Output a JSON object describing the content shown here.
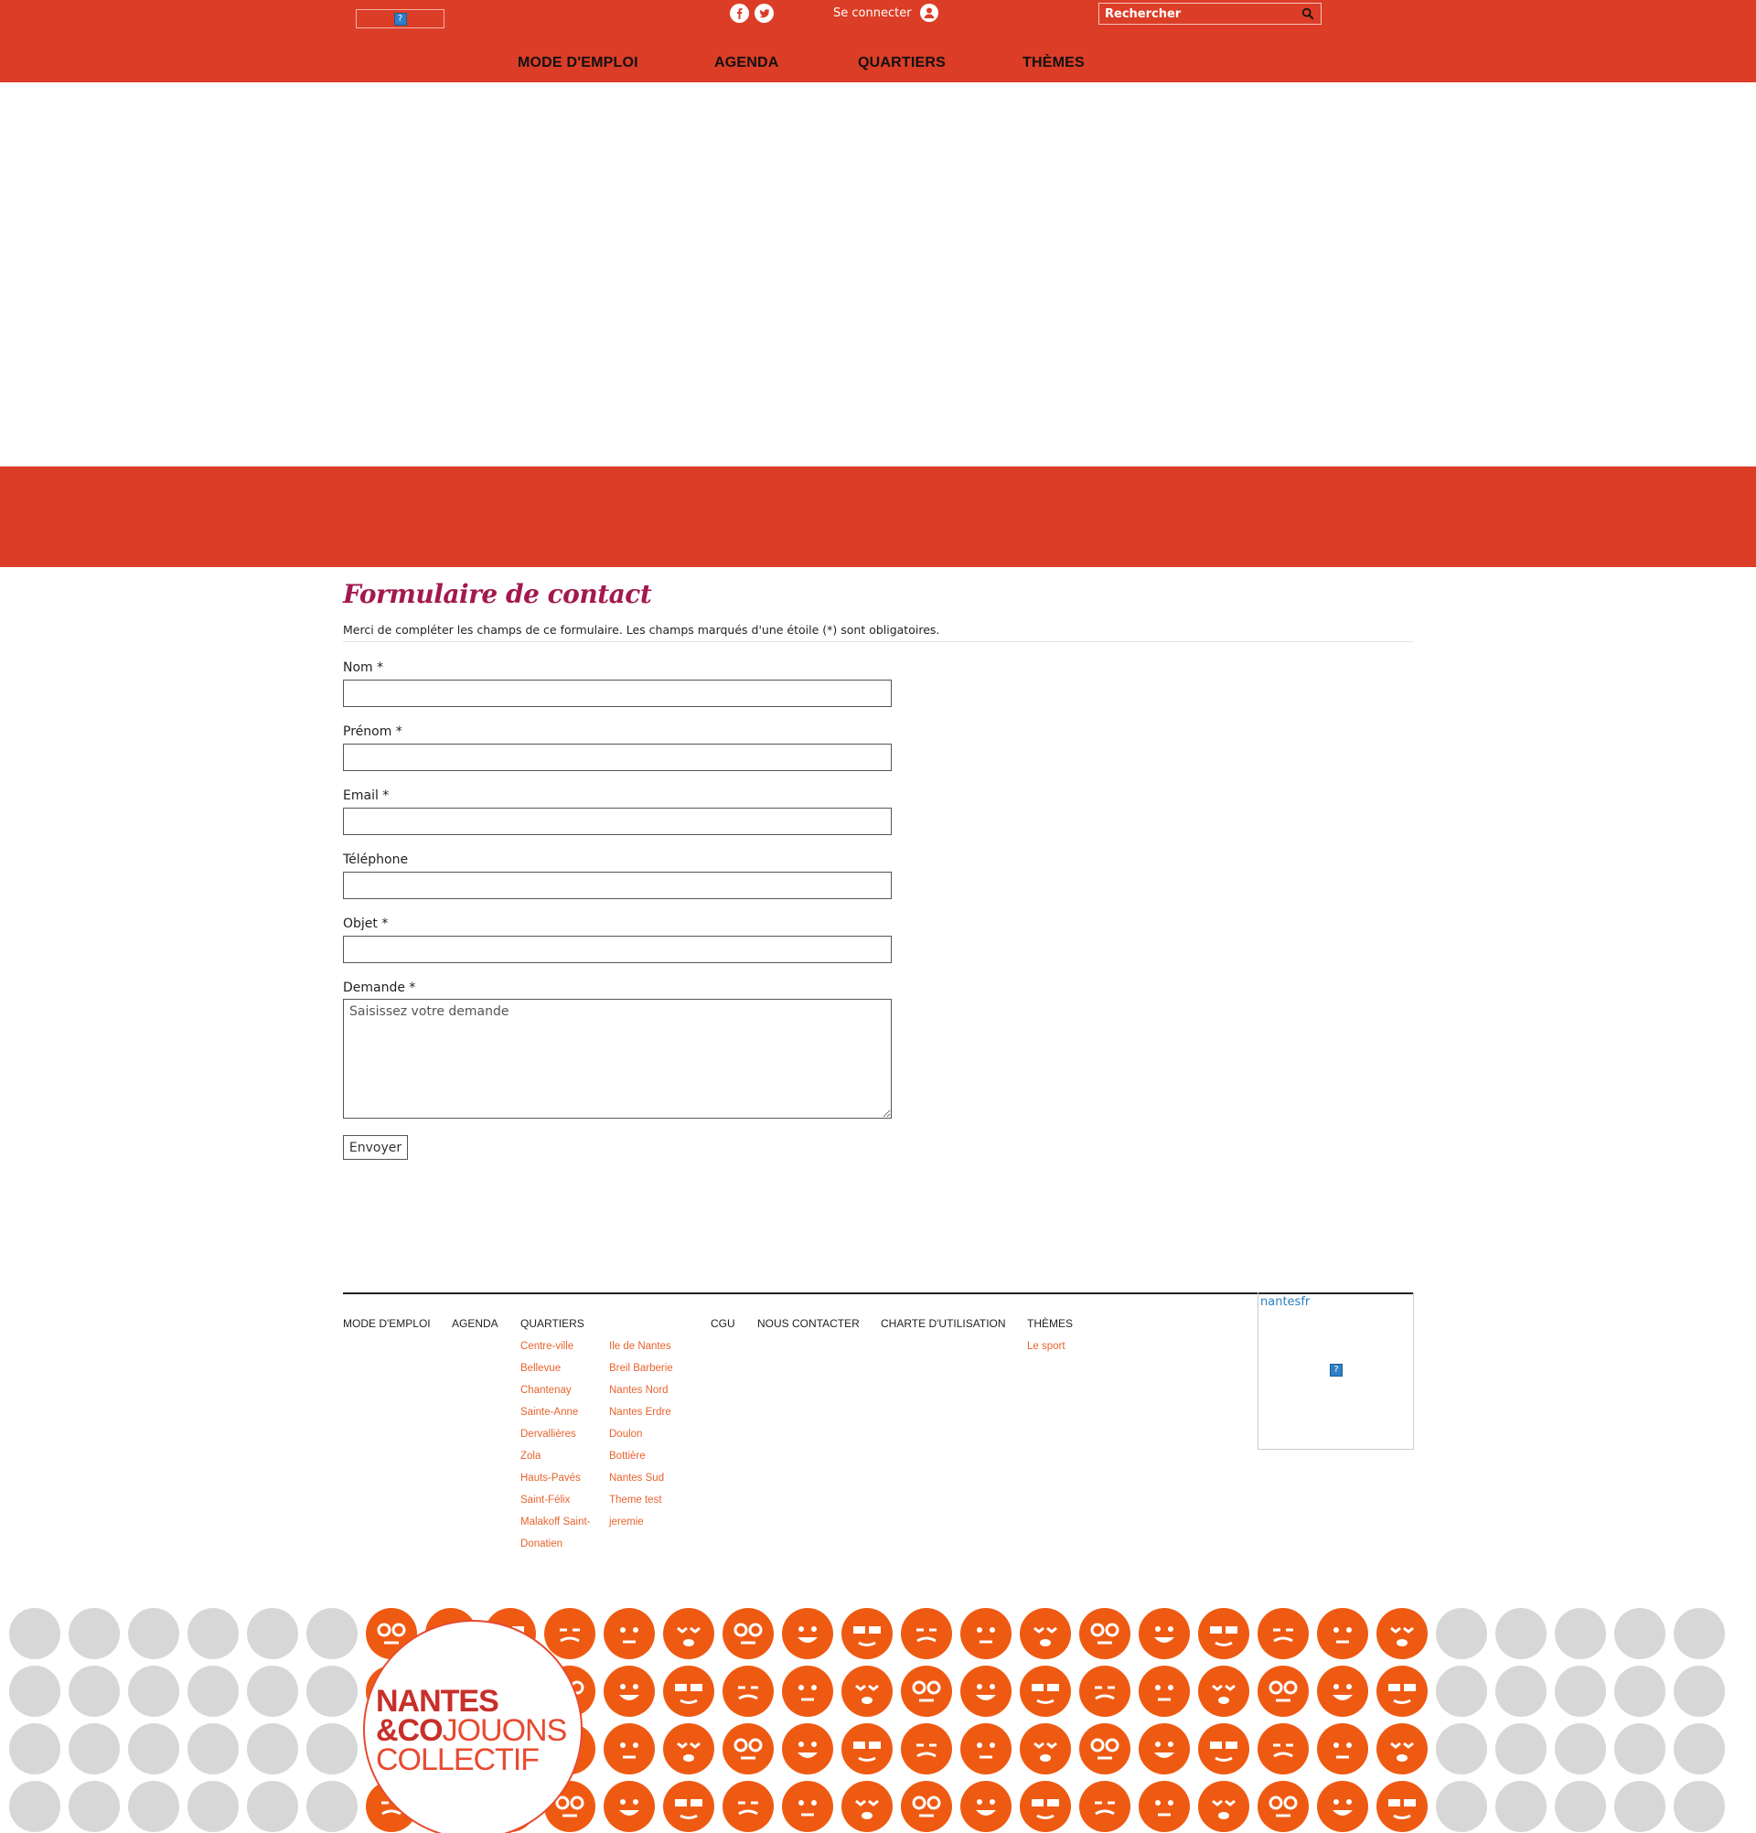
{
  "header": {
    "search_placeholder": "Rechercher",
    "login_label": "Se connecter",
    "nav": [
      "MODE D'EMPLOI",
      "AGENDA",
      "QUARTIERS",
      "THÈMES"
    ],
    "broken_image_glyph": "?",
    "social": [
      "facebook-icon",
      "twitter-icon"
    ]
  },
  "contact": {
    "title": "Formulaire de contact",
    "intro": "Merci de compléter les champs de ce formulaire. Les champs marqués d'une étoile (*) sont obligatoires.",
    "fields": [
      {
        "label": "Nom *",
        "value": ""
      },
      {
        "label": "Prénom *",
        "value": ""
      },
      {
        "label": "Email *",
        "value": ""
      },
      {
        "label": "Téléphone",
        "value": ""
      },
      {
        "label": "Objet *",
        "value": ""
      }
    ],
    "demande_label": "Demande *",
    "demande_placeholder": "Saisissez votre demande",
    "submit": "Envoyer"
  },
  "footer": {
    "nav": [
      "MODE D'EMPLOI",
      "AGENDA",
      "QUARTIERS",
      "CGU",
      "NOUS CONTACTER",
      "CHARTE D'UTILISATION",
      "THÈMES"
    ],
    "quartiers_col1": [
      "Centre-ville",
      "Bellevue",
      "Chantenay",
      "Sainte-Anne",
      "Dervallières",
      "Zola",
      "Hauts-Pavés",
      "Saint-Félix",
      "Malakoff Saint-",
      "Donatien"
    ],
    "quartiers_col2": [
      "Ile de Nantes",
      "Breil Barberie",
      "Nantes Nord",
      "Nantes Erdre",
      "Doulon",
      "Bottière",
      "Nantes Sud",
      "Theme test",
      "jeremie"
    ],
    "themes": [
      "Le sport"
    ],
    "twitter_handle": "nantesfr"
  },
  "brand": {
    "line1": "NANTES",
    "line2_bold": "&CO",
    "line2_rest": "JOUONS",
    "line3": "COLLECTIF"
  },
  "colors": {
    "header_red": "#dc3d26",
    "title_magenta": "#a3194e",
    "footer_link_orange": "#e8632c",
    "emoji_orange": "#ef5a12",
    "emoji_grey": "#d7d7d7"
  }
}
